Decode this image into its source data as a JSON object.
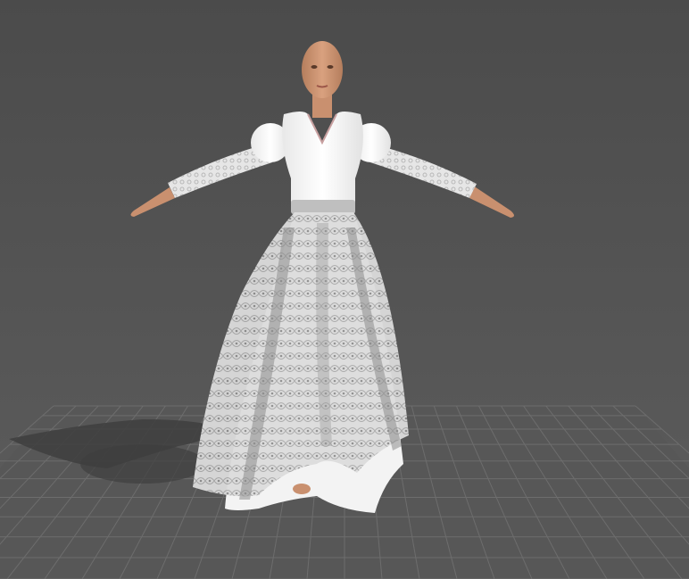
{
  "viewport": {
    "background_top": "#4b4b4b",
    "background_bottom": "#5a5a5a",
    "grid_line_color": "#6b6b6b",
    "grid_floor_color": "#575757"
  },
  "avatar": {
    "skin_color": "#c9906f",
    "garment_color": "#f2f2f2",
    "lace_color": "#d9d9d9",
    "waistband_color": "#bfbfbf"
  }
}
